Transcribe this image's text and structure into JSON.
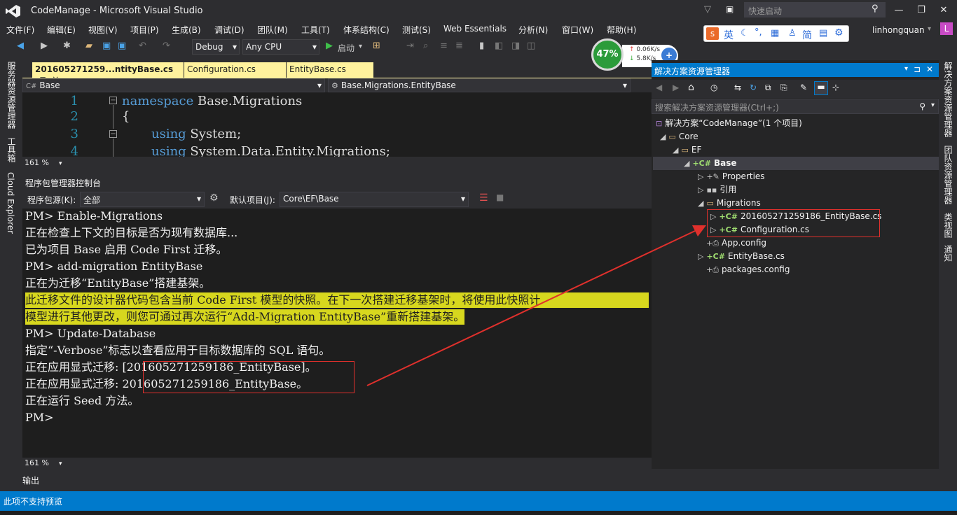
{
  "window": {
    "title": "CodeManage - Microsoft Visual Studio",
    "quick_launch_placeholder": "快速启动",
    "user": "linhongquan",
    "avatar_letter": "L"
  },
  "menu": [
    "文件(F)",
    "编辑(E)",
    "视图(V)",
    "项目(P)",
    "生成(B)",
    "调试(D)",
    "团队(M)",
    "工具(T)",
    "体系结构(C)",
    "测试(S)",
    "Web Essentials",
    "分析(N)",
    "窗口(W)",
    "帮助(H)"
  ],
  "toolbar": {
    "config": "Debug",
    "platform": "Any CPU",
    "start_label": "启动"
  },
  "perf_widget": {
    "percent": "47%",
    "up": "0.06K/s",
    "down": "5.8K/s"
  },
  "ime": {
    "label1": "英",
    "label2": "简"
  },
  "left_strip": [
    "服务器资源管理器",
    "工具箱",
    "Cloud Explorer"
  ],
  "right_strip": [
    "解决方案资源管理器",
    "团队资源管理器",
    "类视图",
    "通知"
  ],
  "tabs": [
    {
      "label": "201605271259...ntityBase.cs",
      "pin": "⊐",
      "close": "×"
    },
    {
      "label": "Configuration.cs"
    },
    {
      "label": "EntityBase.cs"
    }
  ],
  "nav": {
    "project": "Base",
    "type": "Base.Migrations.EntityBase"
  },
  "editor": {
    "lines": [
      {
        "n": "1",
        "kw": "namespace",
        "rest": " Base.Migrations"
      },
      {
        "n": "2",
        "kw": "",
        "rest": "{"
      },
      {
        "n": "3",
        "kw": "using",
        "rest": " System;"
      },
      {
        "n": "4",
        "kw": "using",
        "rest": " System.Data.Entity.Migrations;"
      }
    ],
    "zoom": "161 %"
  },
  "pmc": {
    "title": "程序包管理器控制台",
    "source_label": "程序包源(K):",
    "source_value": "全部",
    "project_label": "默认项目(J):",
    "project_value": "Core\\EF\\Base",
    "lines": [
      "PM> Enable-Migrations",
      "正在检查上下文的目标是否为现有数据库...",
      "已为项目 Base 启用 Code First 迁移。",
      "PM> add-migration EntityBase",
      "正在为迁移“EntityBase”搭建基架。",
      "此迁移文件的设计器代码包含当前 Code First 模型的快照。在下一次搭建迁移基架时，将使用此快照计",
      "模型进行其他更改，则您可通过再次运行“Add-Migration EntityBase”重新搭建基架。",
      "PM> Update-Database",
      "指定“-Verbose”标志以查看应用于目标数据库的 SQL 语句。",
      "正在应用显式迁移: [201605271259186_EntityBase]。",
      "正在应用显式迁移: 201605271259186_EntityBase。",
      "正在运行 Seed 方法。",
      "PM>"
    ],
    "zoom": "161 %"
  },
  "output_tab": "输出",
  "status": "此项不支持预览",
  "solution_explorer": {
    "title": "解决方案资源管理器",
    "search_placeholder": "搜索解决方案资源管理器(Ctrl+;)",
    "nodes": [
      {
        "label": "解决方案“CodeManage”(1 个项目)",
        "icon": "sln"
      },
      {
        "label": "Core",
        "icon": "folder"
      },
      {
        "label": "EF",
        "icon": "folder"
      },
      {
        "label": "Base",
        "icon": "csproj"
      },
      {
        "label": "Properties",
        "icon": "wrench"
      },
      {
        "label": "引用",
        "icon": "ref"
      },
      {
        "label": "Migrations",
        "icon": "folder"
      },
      {
        "label": "201605271259186_EntityBase.cs",
        "icon": "cs"
      },
      {
        "label": "Configuration.cs",
        "icon": "cs"
      },
      {
        "label": "App.config",
        "icon": "config"
      },
      {
        "label": "EntityBase.cs",
        "icon": "cs"
      },
      {
        "label": "packages.config",
        "icon": "config"
      }
    ]
  },
  "colors": {
    "accent": "#007acc",
    "highlight": "#d7d71e",
    "annotation": "#e0302c",
    "tab": "#fff29d"
  }
}
